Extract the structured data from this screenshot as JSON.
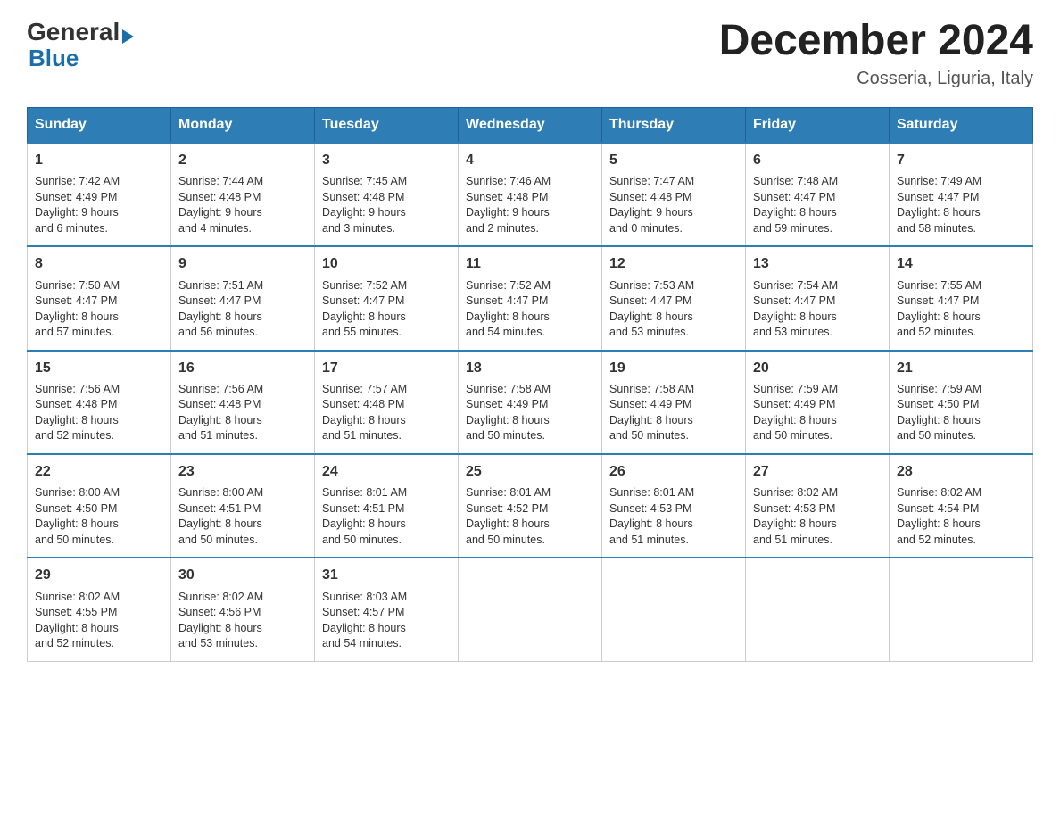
{
  "logo": {
    "general": "General",
    "blue": "Blue"
  },
  "title": "December 2024",
  "location": "Cosseria, Liguria, Italy",
  "weekdays": [
    "Sunday",
    "Monday",
    "Tuesday",
    "Wednesday",
    "Thursday",
    "Friday",
    "Saturday"
  ],
  "weeks": [
    [
      {
        "day": "1",
        "sunrise": "7:42 AM",
        "sunset": "4:49 PM",
        "daylight": "9 hours and 6 minutes."
      },
      {
        "day": "2",
        "sunrise": "7:44 AM",
        "sunset": "4:48 PM",
        "daylight": "9 hours and 4 minutes."
      },
      {
        "day": "3",
        "sunrise": "7:45 AM",
        "sunset": "4:48 PM",
        "daylight": "9 hours and 3 minutes."
      },
      {
        "day": "4",
        "sunrise": "7:46 AM",
        "sunset": "4:48 PM",
        "daylight": "9 hours and 2 minutes."
      },
      {
        "day": "5",
        "sunrise": "7:47 AM",
        "sunset": "4:48 PM",
        "daylight": "9 hours and 0 minutes."
      },
      {
        "day": "6",
        "sunrise": "7:48 AM",
        "sunset": "4:47 PM",
        "daylight": "8 hours and 59 minutes."
      },
      {
        "day": "7",
        "sunrise": "7:49 AM",
        "sunset": "4:47 PM",
        "daylight": "8 hours and 58 minutes."
      }
    ],
    [
      {
        "day": "8",
        "sunrise": "7:50 AM",
        "sunset": "4:47 PM",
        "daylight": "8 hours and 57 minutes."
      },
      {
        "day": "9",
        "sunrise": "7:51 AM",
        "sunset": "4:47 PM",
        "daylight": "8 hours and 56 minutes."
      },
      {
        "day": "10",
        "sunrise": "7:52 AM",
        "sunset": "4:47 PM",
        "daylight": "8 hours and 55 minutes."
      },
      {
        "day": "11",
        "sunrise": "7:52 AM",
        "sunset": "4:47 PM",
        "daylight": "8 hours and 54 minutes."
      },
      {
        "day": "12",
        "sunrise": "7:53 AM",
        "sunset": "4:47 PM",
        "daylight": "8 hours and 53 minutes."
      },
      {
        "day": "13",
        "sunrise": "7:54 AM",
        "sunset": "4:47 PM",
        "daylight": "8 hours and 53 minutes."
      },
      {
        "day": "14",
        "sunrise": "7:55 AM",
        "sunset": "4:47 PM",
        "daylight": "8 hours and 52 minutes."
      }
    ],
    [
      {
        "day": "15",
        "sunrise": "7:56 AM",
        "sunset": "4:48 PM",
        "daylight": "8 hours and 52 minutes."
      },
      {
        "day": "16",
        "sunrise": "7:56 AM",
        "sunset": "4:48 PM",
        "daylight": "8 hours and 51 minutes."
      },
      {
        "day": "17",
        "sunrise": "7:57 AM",
        "sunset": "4:48 PM",
        "daylight": "8 hours and 51 minutes."
      },
      {
        "day": "18",
        "sunrise": "7:58 AM",
        "sunset": "4:49 PM",
        "daylight": "8 hours and 50 minutes."
      },
      {
        "day": "19",
        "sunrise": "7:58 AM",
        "sunset": "4:49 PM",
        "daylight": "8 hours and 50 minutes."
      },
      {
        "day": "20",
        "sunrise": "7:59 AM",
        "sunset": "4:49 PM",
        "daylight": "8 hours and 50 minutes."
      },
      {
        "day": "21",
        "sunrise": "7:59 AM",
        "sunset": "4:50 PM",
        "daylight": "8 hours and 50 minutes."
      }
    ],
    [
      {
        "day": "22",
        "sunrise": "8:00 AM",
        "sunset": "4:50 PM",
        "daylight": "8 hours and 50 minutes."
      },
      {
        "day": "23",
        "sunrise": "8:00 AM",
        "sunset": "4:51 PM",
        "daylight": "8 hours and 50 minutes."
      },
      {
        "day": "24",
        "sunrise": "8:01 AM",
        "sunset": "4:51 PM",
        "daylight": "8 hours and 50 minutes."
      },
      {
        "day": "25",
        "sunrise": "8:01 AM",
        "sunset": "4:52 PM",
        "daylight": "8 hours and 50 minutes."
      },
      {
        "day": "26",
        "sunrise": "8:01 AM",
        "sunset": "4:53 PM",
        "daylight": "8 hours and 51 minutes."
      },
      {
        "day": "27",
        "sunrise": "8:02 AM",
        "sunset": "4:53 PM",
        "daylight": "8 hours and 51 minutes."
      },
      {
        "day": "28",
        "sunrise": "8:02 AM",
        "sunset": "4:54 PM",
        "daylight": "8 hours and 52 minutes."
      }
    ],
    [
      {
        "day": "29",
        "sunrise": "8:02 AM",
        "sunset": "4:55 PM",
        "daylight": "8 hours and 52 minutes."
      },
      {
        "day": "30",
        "sunrise": "8:02 AM",
        "sunset": "4:56 PM",
        "daylight": "8 hours and 53 minutes."
      },
      {
        "day": "31",
        "sunrise": "8:03 AM",
        "sunset": "4:57 PM",
        "daylight": "8 hours and 54 minutes."
      },
      null,
      null,
      null,
      null
    ]
  ],
  "labels": {
    "sunrise": "Sunrise:",
    "sunset": "Sunset:",
    "daylight": "Daylight:"
  }
}
